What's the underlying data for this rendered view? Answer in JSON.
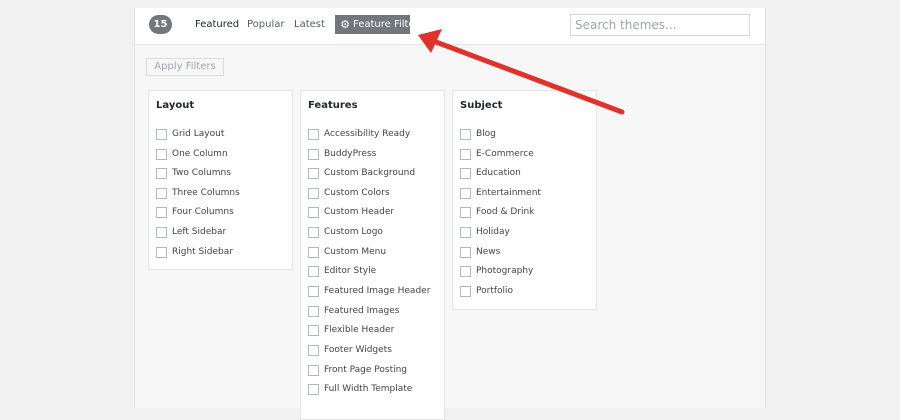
{
  "header": {
    "count": "15",
    "tabs": [
      {
        "label": "Featured"
      },
      {
        "label": "Popular"
      },
      {
        "label": "Latest"
      }
    ],
    "feature_filter_label": "Feature Filter",
    "search_placeholder": "Search themes..."
  },
  "apply_filters_label": "Apply Filters",
  "filter_groups": [
    {
      "title": "Layout",
      "options": [
        "Grid Layout",
        "One Column",
        "Two Columns",
        "Three Columns",
        "Four Columns",
        "Left Sidebar",
        "Right Sidebar"
      ]
    },
    {
      "title": "Features",
      "options": [
        "Accessibility Ready",
        "BuddyPress",
        "Custom Background",
        "Custom Colors",
        "Custom Header",
        "Custom Logo",
        "Custom Menu",
        "Editor Style",
        "Featured Image Header",
        "Featured Images",
        "Flexible Header",
        "Footer Widgets",
        "Front Page Posting",
        "Full Width Template"
      ]
    },
    {
      "title": "Subject",
      "options": [
        "Blog",
        "E-Commerce",
        "Education",
        "Entertainment",
        "Food & Drink",
        "Holiday",
        "News",
        "Photography",
        "Portfolio"
      ]
    }
  ],
  "colors": {
    "annotation_arrow": "#e0322b",
    "badge": "#72777c"
  },
  "icons": {
    "feature_filter": "gear-icon"
  }
}
